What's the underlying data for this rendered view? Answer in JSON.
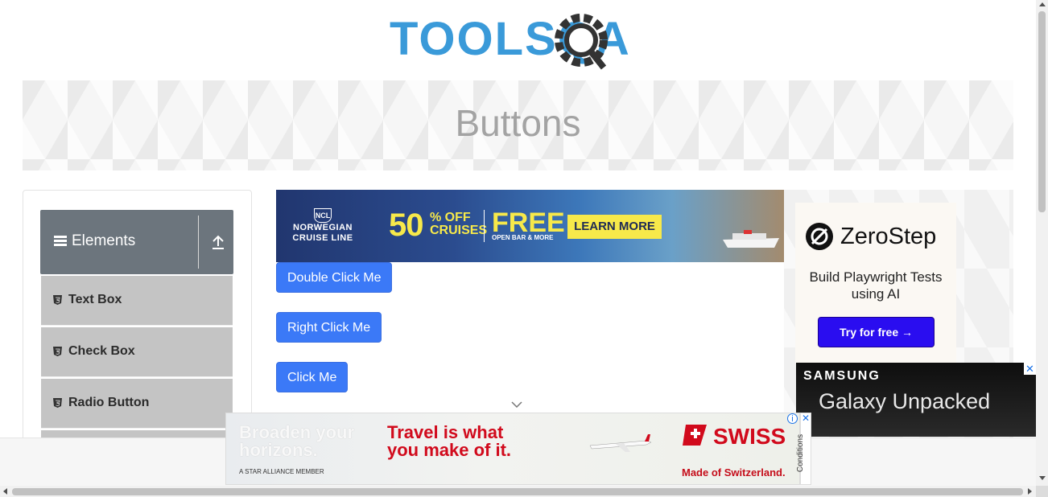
{
  "site": {
    "logo_text": "TOOLSQA"
  },
  "banner": {
    "title": "Buttons"
  },
  "sidebar": {
    "group_title": "Elements",
    "items": [
      {
        "label": "Text Box"
      },
      {
        "label": "Check Box"
      },
      {
        "label": "Radio Button"
      }
    ]
  },
  "buttons": {
    "double_click": "Double Click Me",
    "right_click": "Right Click Me",
    "click": "Click Me"
  },
  "ads": {
    "ncl": {
      "brand_badge": "NCL",
      "brand_name_1": "NORWEGIAN",
      "brand_name_2": "CRUISE LINE",
      "discount": "50",
      "discount_pct": "% OFF",
      "discount_word": "CRUISES",
      "free": "FREE",
      "free_sub": "OPEN BAR & MORE",
      "cta": "LEARN MORE"
    },
    "zerostep": {
      "name": "ZeroStep",
      "tagline": "Build Playwright Tests using AI",
      "cta": "Try for free →"
    },
    "samsung": {
      "brand": "SAMSUNG",
      "title": "Galaxy Unpacked"
    },
    "swiss": {
      "headline_1": "Broaden your horizons.",
      "headline_2": "Travel is what you make of it.",
      "star_alliance": "A STAR ALLIANCE MEMBER",
      "brand": "SWISS",
      "tagline": "Made of Switzerland.",
      "conditions": "Conditions"
    }
  },
  "colors": {
    "primary_button": "#3b79f7",
    "sidebar_header": "#6c757d",
    "sidebar_item": "#c4c4c4",
    "logo_blue": "#3a9ad9",
    "logo_dark": "#333333"
  }
}
